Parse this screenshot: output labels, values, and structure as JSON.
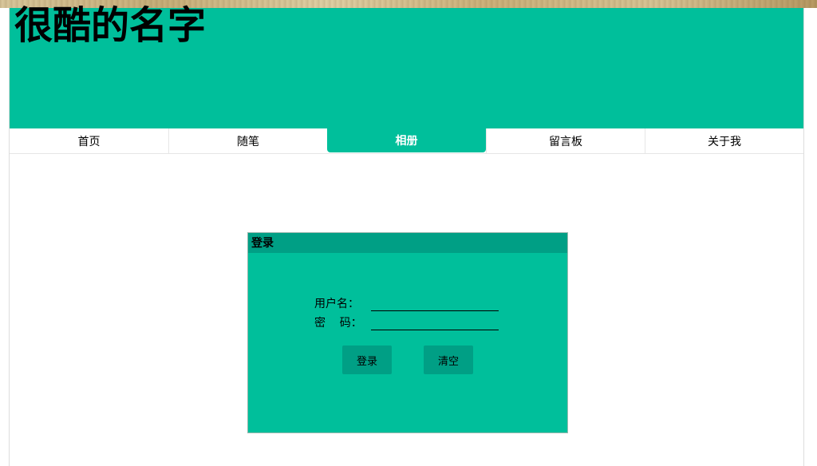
{
  "header": {
    "title": "很酷的名字"
  },
  "nav": {
    "items": [
      {
        "label": "首页",
        "active": false
      },
      {
        "label": "随笔",
        "active": false
      },
      {
        "label": "相册",
        "active": true
      },
      {
        "label": "留言板",
        "active": false
      },
      {
        "label": "关于我",
        "active": false
      }
    ]
  },
  "login": {
    "title": "登录",
    "username_label": "用户名：",
    "username_value": "",
    "password_label": "密    码：",
    "password_value": "",
    "submit_label": "登录",
    "clear_label": "清空"
  },
  "colors": {
    "accent": "#00bf9b",
    "accent_dark": "#009f85"
  }
}
